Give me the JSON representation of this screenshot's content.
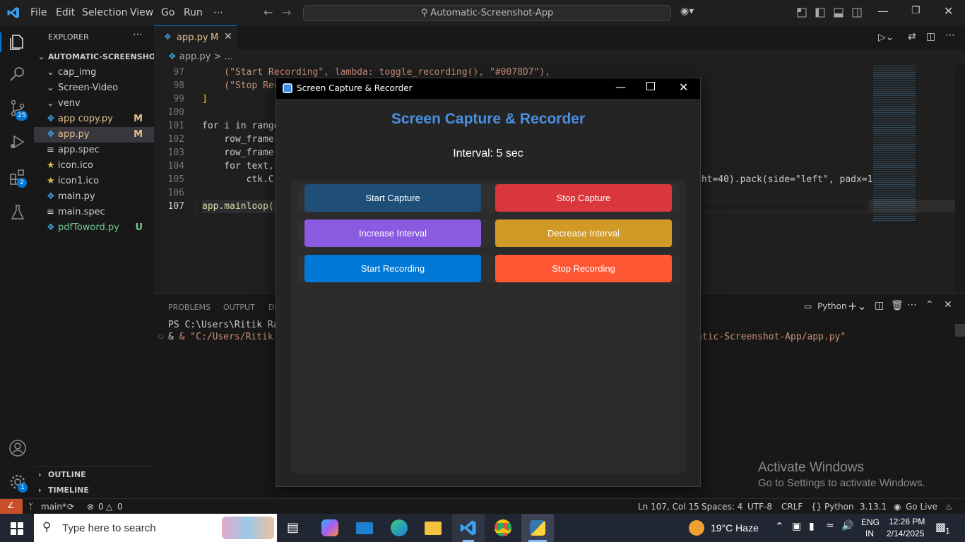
{
  "menu": [
    "File",
    "Edit",
    "Selection",
    "View",
    "Go",
    "Run",
    "⋯"
  ],
  "search": {
    "text": "Automatic-Screenshot-App"
  },
  "activity_badges": {
    "source_control": "25",
    "extensions": "2",
    "accounts_manage": "1"
  },
  "sidebar": {
    "title": "EXPLORER",
    "project": "AUTOMATIC-SCREENSHOT...",
    "items": [
      {
        "label": "cap_img",
        "type": "folder",
        "status": ""
      },
      {
        "label": "Screen-Video",
        "type": "folder",
        "status": ""
      },
      {
        "label": "venv",
        "type": "folder",
        "status": ""
      },
      {
        "label": "app copy.py",
        "type": "py",
        "status": "M"
      },
      {
        "label": "app.py",
        "type": "py",
        "status": "M"
      },
      {
        "label": "app.spec",
        "type": "spec",
        "status": ""
      },
      {
        "label": "icon.ico",
        "type": "ico",
        "status": ""
      },
      {
        "label": "icon1.ico",
        "type": "ico",
        "status": ""
      },
      {
        "label": "main.py",
        "type": "py",
        "status": ""
      },
      {
        "label": "main.spec",
        "type": "spec",
        "status": ""
      },
      {
        "label": "pdfToword.py",
        "type": "py",
        "status": "U"
      }
    ],
    "outline": "OUTLINE",
    "timeline": "TIMELINE"
  },
  "editor": {
    "tab": {
      "label": "app.py",
      "status": "M"
    },
    "breadcrumb": "app.py > ...",
    "lines": [
      {
        "n": "97",
        "text": "    (\"Start Recording\", lambda: toggle_recording(), \"#0078D7\"),"
      },
      {
        "n": "98",
        "text": "    (\"Stop Rec"
      },
      {
        "n": "99",
        "text": "]"
      },
      {
        "n": "100",
        "text": ""
      },
      {
        "n": "101",
        "text": "for i in range"
      },
      {
        "n": "102",
        "text": "    row_frame "
      },
      {
        "n": "103",
        "text": "    row_frame."
      },
      {
        "n": "104",
        "text": "    for text,"
      },
      {
        "n": "105",
        "text": "        ctk.C"
      },
      {
        "n": "106",
        "text": ""
      },
      {
        "n": "107",
        "text": "app.mainloop()"
      }
    ],
    "line105_tail": "ght=40).pack(side=\"left\", padx=1"
  },
  "panel": {
    "tabs": [
      "PROBLEMS",
      "OUTPUT",
      "DE"
    ],
    "terminal_label": "Python",
    "terminal_lines": [
      "PS C:\\Users\\Ritik Rai\\",
      "& \"C:/Users/Ritik Rai/"
    ],
    "terminal_tail": "atic-Screenshot-App/app.py\""
  },
  "app_window": {
    "title": "Screen Capture & Recorder",
    "heading": "Screen Capture & Recorder",
    "interval": "Interval: 5 sec",
    "buttons": [
      {
        "label": "Start Capture",
        "color": "#1F4E79"
      },
      {
        "label": "Stop Capture",
        "color": "#D9363E"
      },
      {
        "label": "Increase Interval",
        "color": "#8A5AE0"
      },
      {
        "label": "Decrease Interval",
        "color": "#D19A26"
      },
      {
        "label": "Start Recording",
        "color": "#0078D7"
      },
      {
        "label": "Stop Recording",
        "color": "#FF5733"
      }
    ]
  },
  "watermark": {
    "line1": "Activate Windows",
    "line2": "Go to Settings to activate Windows."
  },
  "status": {
    "branch": "main*",
    "errors": "0",
    "warnings": "0",
    "position": "Ln 107, Col 15",
    "spaces": "Spaces: 4",
    "encoding": "UTF-8",
    "eol": "CRLF",
    "language": "Python",
    "version": "3.13.1",
    "golive": "Go Live"
  },
  "taskbar": {
    "search_placeholder": "Type here to search",
    "weather": "19°C  Haze",
    "lang1": "ENG",
    "lang2": "IN",
    "time": "12:26 PM",
    "date": "2/14/2025",
    "notifications": "1"
  }
}
